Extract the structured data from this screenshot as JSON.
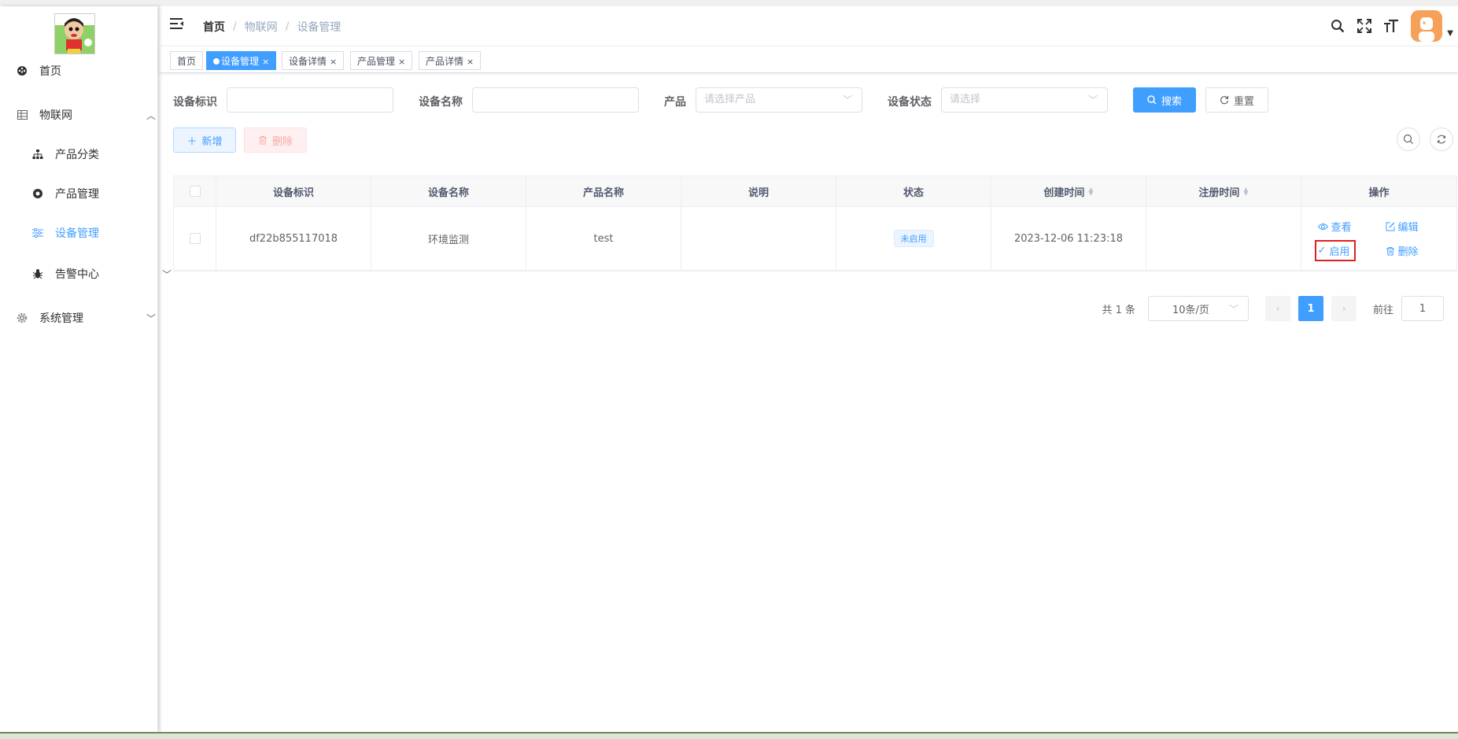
{
  "sidebar": {
    "items": [
      {
        "label": "首页",
        "icon": "dashboard-icon"
      },
      {
        "label": "物联网",
        "icon": "table-icon"
      },
      {
        "label": "产品分类",
        "icon": "tree-icon"
      },
      {
        "label": "产品管理",
        "icon": "cog-circle-icon"
      },
      {
        "label": "设备管理",
        "icon": "sliders-icon"
      },
      {
        "label": "告警中心",
        "icon": "bug-icon"
      },
      {
        "label": "系统管理",
        "icon": "gear-icon"
      }
    ]
  },
  "breadcrumb": [
    "首页",
    "物联网",
    "设备管理"
  ],
  "breadcrumb_sep": "/",
  "tags": [
    "首页",
    "设备管理",
    "设备详情",
    "产品管理",
    "产品详情"
  ],
  "tag_close": "×",
  "search": {
    "id_label": "设备标识",
    "name_label": "设备名称",
    "product_label": "产品",
    "product_placeholder": "请选择产品",
    "status_label": "设备状态",
    "status_placeholder": "请选择",
    "search_btn": "搜索",
    "reset_btn": "重置"
  },
  "toolbar": {
    "add": "新增",
    "delete": "删除"
  },
  "table": {
    "headers": [
      "设备标识",
      "设备名称",
      "产品名称",
      "说明",
      "状态",
      "创建时间",
      "注册时间",
      "操作"
    ],
    "rows": [
      {
        "device_id": "df22b855117018",
        "device_name": "环境监测",
        "product_name": "test",
        "desc": "",
        "status": "未启用",
        "created": "2023-12-06 11:23:18",
        "registered": "",
        "ops": {
          "view": "查看",
          "edit": "编辑",
          "enable": "启用",
          "delete": "删除"
        }
      }
    ]
  },
  "pagination": {
    "total": "共 1 条",
    "page_size": "10条/页",
    "current": "1",
    "goto_label": "前往",
    "goto_value": "1"
  },
  "colors": {
    "primary": "#409eff",
    "highlight": "#e02020"
  }
}
